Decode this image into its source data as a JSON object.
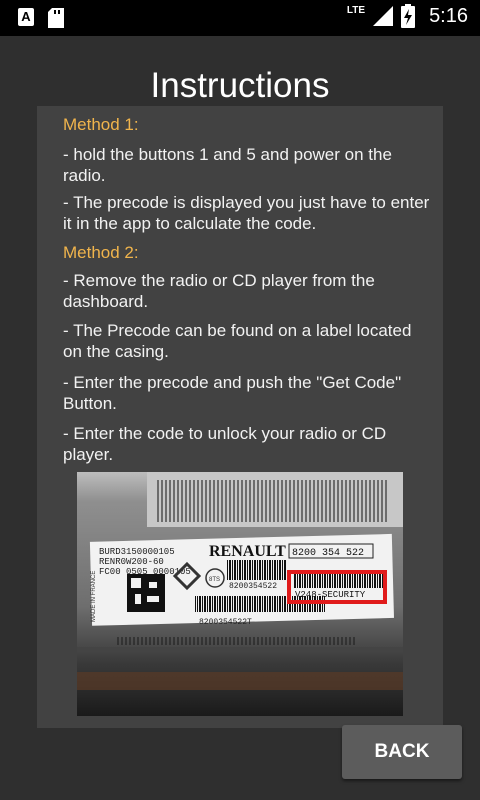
{
  "status_bar": {
    "time": "5:16",
    "network": "LTE",
    "notification_icon_letter": "A"
  },
  "page": {
    "title": "Instructions"
  },
  "instructions": {
    "method1_heading": "Method 1:",
    "method1_steps": [
      "- hold the buttons 1 and 5 and power on the radio.",
      "- The precode is displayed you just have to enter it  in the app to calculate the code."
    ],
    "method2_heading": "Method 2:",
    "method2_steps": [
      "- Remove the radio or CD player from the dashboard.",
      "- The Precode can be found on a label located on the casing.",
      "- Enter the precode and push the \"Get Code\" Button.",
      "- Enter the code to unlock your radio or CD player."
    ]
  },
  "radio_label_photo": {
    "brand": "RENAULT",
    "part_number": "8200 354 522",
    "precode_label": "V248-SECURITY",
    "line1": "BURD3150000105",
    "line2": "RENR0W200-60",
    "line3": "FC00 0505 0000105",
    "side_text": "MADE IN FRANCE",
    "barcode_caption": "8200354522T",
    "tag": "8TS",
    "side_code": "8200354522"
  },
  "footer": {
    "back_label": "BACK"
  },
  "colors": {
    "method_heading": "#f0b44c",
    "highlight_box": "#e01b1b",
    "background": "#2f2f2f",
    "panel": "#424242"
  }
}
